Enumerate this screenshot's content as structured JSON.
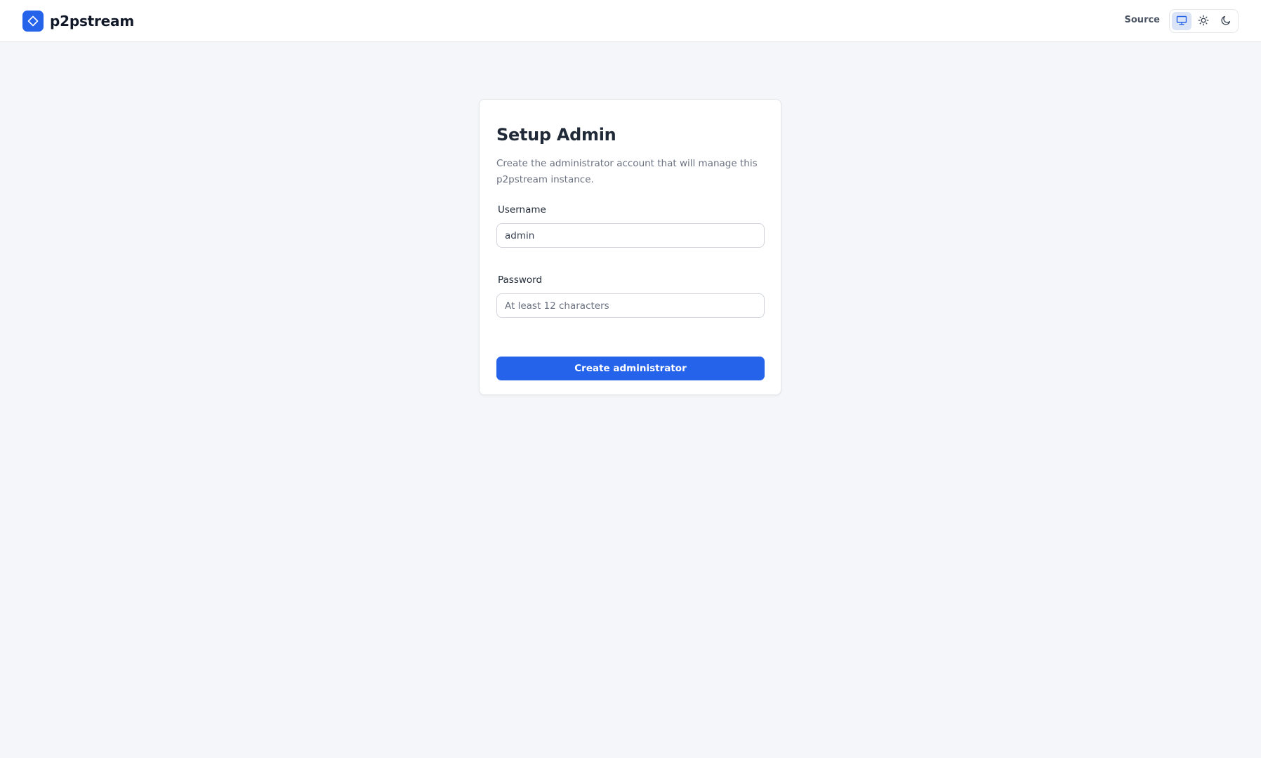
{
  "header": {
    "brand_name": "p2pstream",
    "brand_icon": "diamond-icon",
    "source_label": "Source",
    "theme_options": [
      {
        "icon": "monitor-icon",
        "active": true
      },
      {
        "icon": "sun-icon",
        "active": false
      },
      {
        "icon": "moon-icon",
        "active": false
      }
    ]
  },
  "setup": {
    "title": "Setup Admin",
    "description": "Create the administrator account that will manage this p2pstream instance.",
    "username": {
      "label": "Username",
      "value": "admin",
      "placeholder": ""
    },
    "password": {
      "label": "Password",
      "value": "",
      "placeholder": "At least 12 characters"
    },
    "submit_label": "Create administrator"
  },
  "colors": {
    "accent": "#2563eb",
    "background": "#f5f6f9",
    "surface": "#ffffff",
    "active_toggle": "#dbe4f7"
  }
}
